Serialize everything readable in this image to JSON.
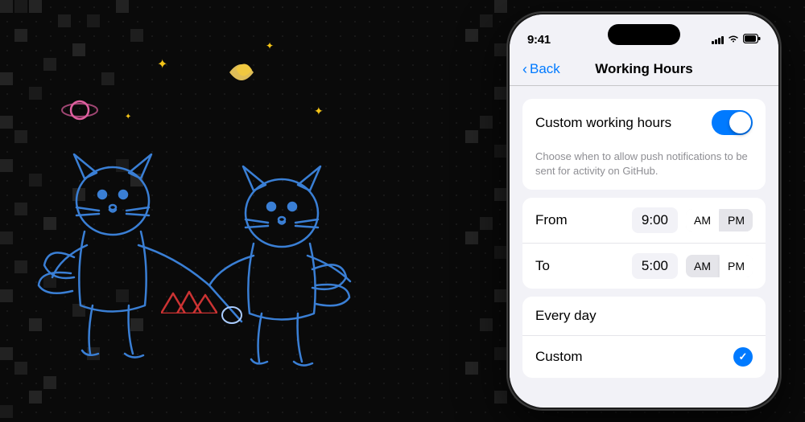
{
  "background": {
    "color": "#0a0a0a"
  },
  "status_bar": {
    "time": "9:41",
    "signal_label": "signal",
    "wifi_label": "wifi",
    "battery_label": "battery"
  },
  "nav": {
    "back_label": "Back",
    "title": "Working Hours"
  },
  "toggle_section": {
    "label": "Custom working hours",
    "description": "Choose when to allow push notifications to be sent for activity on GitHub.",
    "is_on": true
  },
  "from_row": {
    "label": "From",
    "time": "9:00",
    "am_active": true,
    "am_label": "AM",
    "pm_label": "PM"
  },
  "to_row": {
    "label": "To",
    "time": "5:00",
    "am_active": false,
    "am_label": "AM",
    "pm_label": "PM"
  },
  "schedule": {
    "every_day_label": "Every day",
    "custom_label": "Custom",
    "custom_selected": true
  }
}
